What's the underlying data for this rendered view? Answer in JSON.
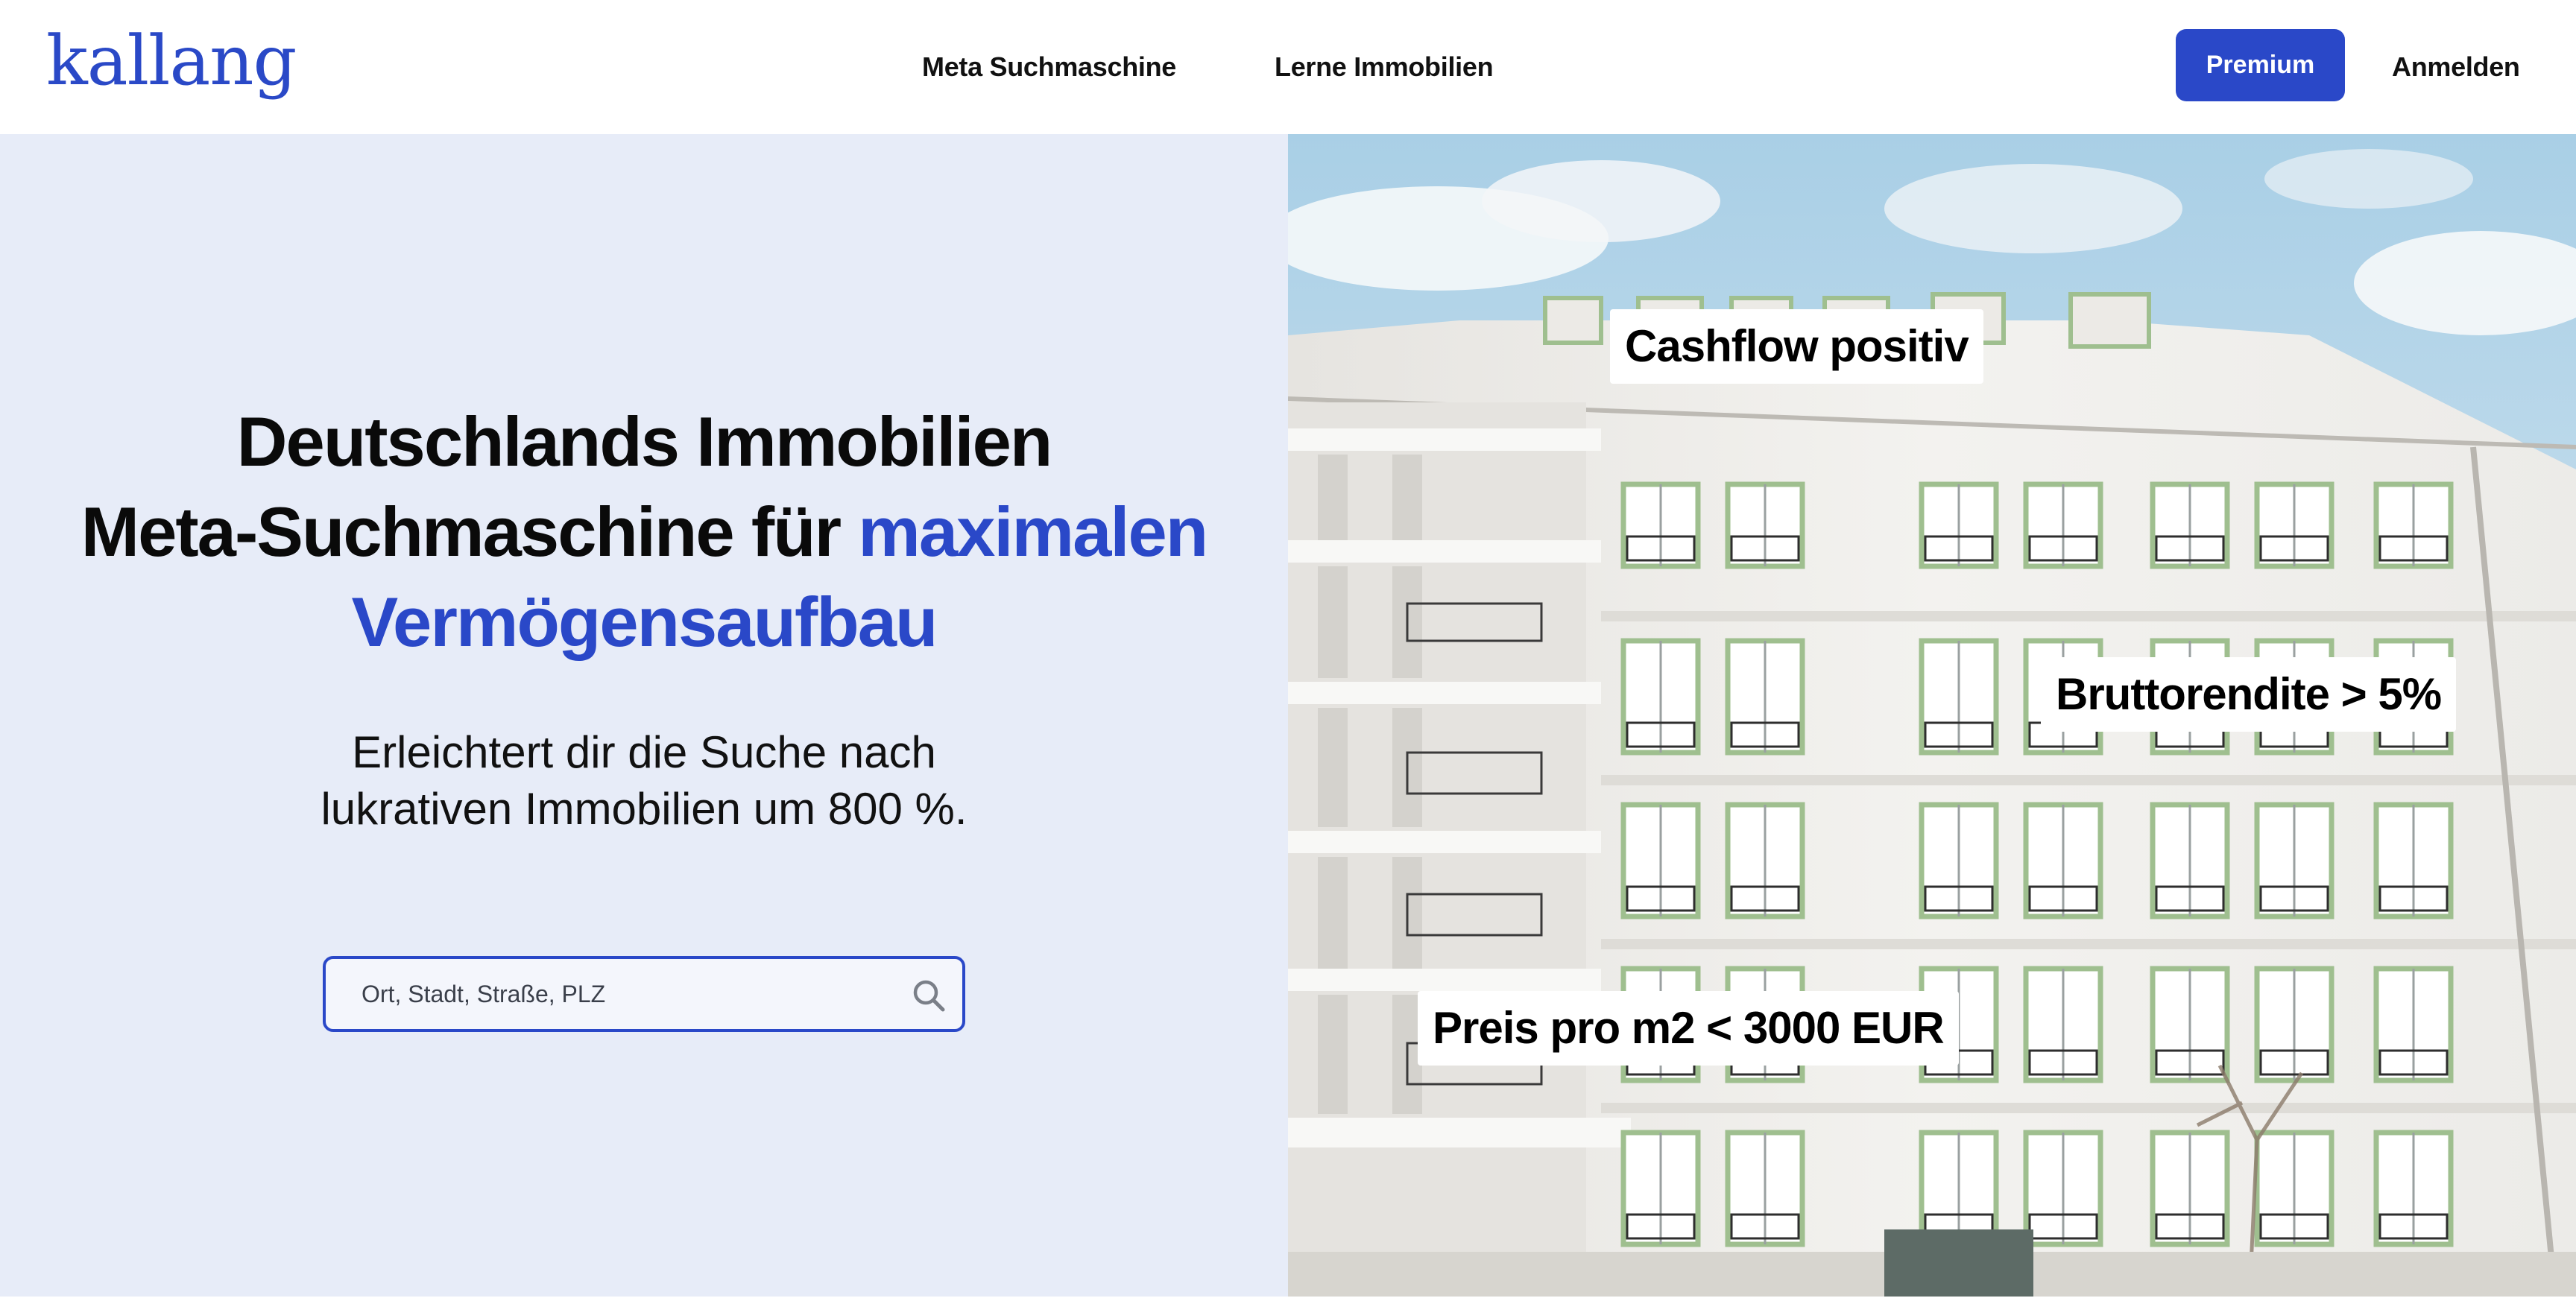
{
  "header": {
    "logo_text": "kallang",
    "nav": {
      "meta_search": "Meta Suchmaschine",
      "learn": "Lerne Immobilien"
    },
    "premium_button": "Premium",
    "login": "Anmelden"
  },
  "hero": {
    "headline_line1": "Deutschlands Immobilien",
    "headline_line2": "Meta-Suchmaschine für",
    "headline_accent1": "maximalen",
    "headline_accent2": "Vermögensaufbau",
    "subline_line1": "Erleichtert dir die Suche nach",
    "subline_line2": "lukrativen Immobilien um 800 %.",
    "search": {
      "placeholder": "Ort, Stadt, Straße, PLZ",
      "icon": "search-icon"
    }
  },
  "image_tags": {
    "cashflow": "Cashflow positiv",
    "brutto": "Bruttorendite > 5%",
    "preis": "Preis pro m2 < 3000 EUR"
  },
  "colors": {
    "accent": "#2a48c8",
    "hero_bg": "#e7ecf8",
    "window_green": "#9fbf8f"
  }
}
